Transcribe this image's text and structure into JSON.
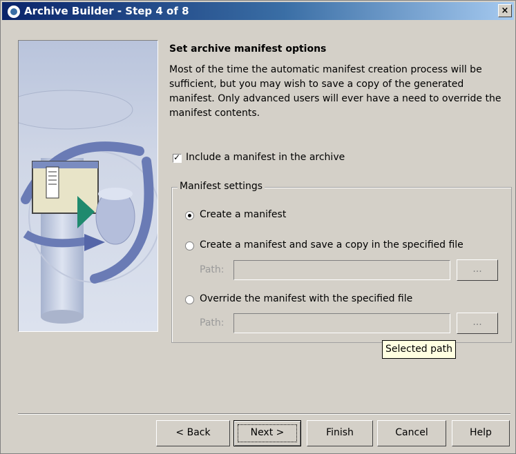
{
  "window": {
    "title": "Archive Builder - Step 4 of 8",
    "close_label": "×"
  },
  "main": {
    "heading": "Set archive manifest options",
    "description": "Most of the time the automatic manifest creation process will be sufficient, but you may wish to save a copy of the generated manifest. Only advanced users will ever have a need to override the manifest contents.",
    "include_manifest": {
      "checked": true,
      "label": "Include a manifest in the archive"
    }
  },
  "manifest_settings": {
    "legend": "Manifest settings",
    "options": [
      {
        "label": "Create a manifest",
        "selected": true
      },
      {
        "label": "Create a manifest and save a copy in the specified file",
        "selected": false
      },
      {
        "label": "Override the manifest with the specified file",
        "selected": false
      }
    ],
    "path_label": "Path:",
    "browse_label": "...",
    "save_path_value": "",
    "override_path_value": ""
  },
  "tooltip": {
    "text": "Selected path"
  },
  "buttons": {
    "back": "< Back",
    "next": "Next >",
    "finish": "Finish",
    "cancel": "Cancel",
    "help": "Help"
  },
  "colors": {
    "title_gradient_start": "#0a246a",
    "title_gradient_end": "#a6caf0",
    "dialog_face": "#d4d0c8",
    "tooltip_bg": "#ffffe1"
  }
}
